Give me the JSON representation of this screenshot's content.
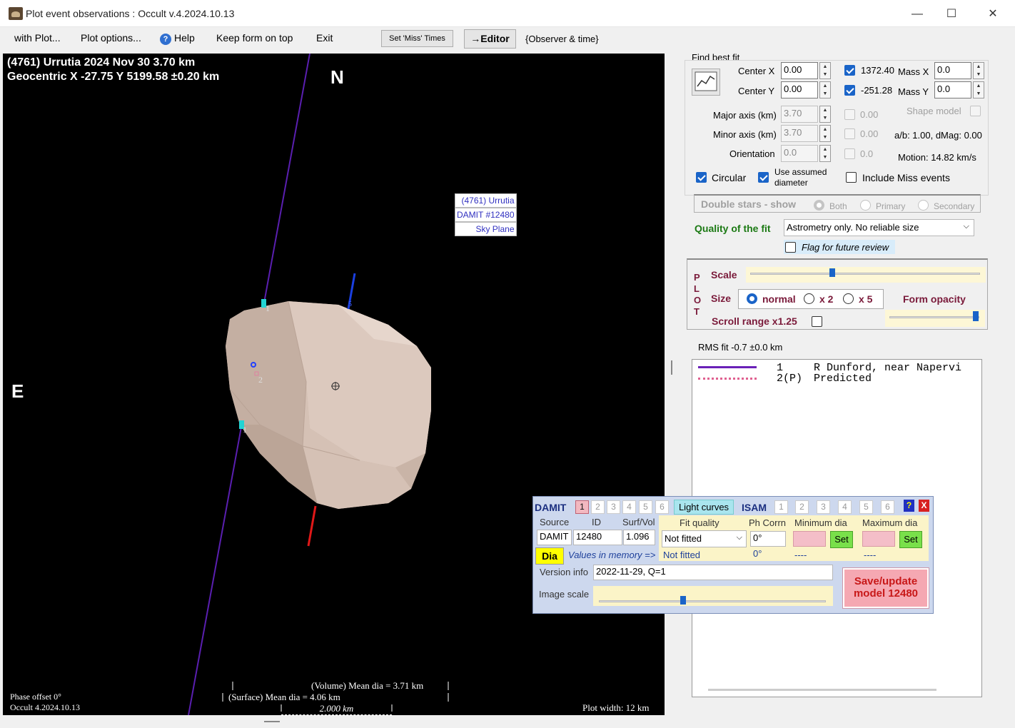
{
  "window": {
    "title": "Plot event observations : Occult v.4.2024.10.13",
    "minimize": "—",
    "maximize": "☐",
    "close": "✕"
  },
  "menu": {
    "with_plot": "with Plot...",
    "plot_options": "Plot options...",
    "help": "Help",
    "help_icon": "?",
    "keep_on_top": "Keep form on top",
    "exit": "Exit",
    "set_miss_times": "Set 'Miss' Times",
    "editor": "→Editor",
    "observer_time": "{Observer & time}"
  },
  "plot": {
    "header_line1": "(4761) Urrutia  2024 Nov 30   3.70 km",
    "header_line2": "Geocentric  X  -27.75  Y 5199.58 ±0.20 km",
    "north": "N",
    "east": "E",
    "model_label": [
      "(4761) Urrutia",
      "DAMIT #12480",
      "Sky Plane"
    ],
    "chord_labels": [
      "1",
      "2",
      "1"
    ],
    "axis_label": "5",
    "volume_mean": "(Volume) Mean dia = 3.71 km",
    "surface_mean": "(Surface) Mean dia = 4.06 km",
    "scale_bar": "2.000 km",
    "phase_offset": "Phase offset 0°",
    "occult_version": "Occult 4.2024.10.13",
    "plot_width": "Plot width: 12 km",
    "colors": {
      "background": "#000000",
      "asteroid": "#d6c3b6",
      "chord1": "#5a1fb0",
      "axis_blue": "#1a3fe0",
      "axis_red": "#e01818",
      "marker": "#22d3d3"
    }
  },
  "fit": {
    "title": "Find best fit",
    "fit_icon": "chart-icon",
    "center_x_label": "Center X",
    "center_x": "0.00",
    "center_y_label": "Center Y",
    "center_y": "0.00",
    "x_value": "1372.40",
    "mass_x_label": "Mass X",
    "mass_x": "0.0",
    "y_value": "-251.28",
    "mass_y_label": "Mass Y",
    "mass_y": "0.0",
    "major_label": "Major axis (km)",
    "major": "3.70",
    "major_extra": "0.00",
    "minor_label": "Minor axis (km)",
    "minor": "3.70",
    "minor_extra": "0.00",
    "orient_label": "Orientation",
    "orient": "0.0",
    "orient_extra": "0.0",
    "shape_model": "Shape model",
    "ab_dmag": "a/b: 1.00, dMag: 0.00",
    "motion": "Motion: 14.82 km/s",
    "circular": "Circular",
    "use_assumed": "Use assumed diameter",
    "include_miss": "Include Miss events"
  },
  "double_stars": {
    "label": "Double stars - show",
    "both": "Both",
    "primary": "Primary",
    "secondary": "Secondary"
  },
  "quality": {
    "label": "Quality of the fit",
    "value": "Astrometry only. No reliable size",
    "flag": "Flag for future review"
  },
  "plotgroup": {
    "letters": [
      "P",
      "L",
      "O",
      "T"
    ],
    "scale": "Scale",
    "size": "Size",
    "normal": "normal",
    "x2": "x 2",
    "x5": "x 5",
    "form_opacity": "Form opacity",
    "scroll_range": "Scroll range x1.25"
  },
  "rms": "RMS fit -0.7 ±0.0 km",
  "observers": [
    {
      "num": "1",
      "name": "R Dunford, near Napervi"
    },
    {
      "num": "2(P)",
      "name": "Predicted"
    }
  ],
  "damit": {
    "title": "DAMIT",
    "nums": [
      "1",
      "2",
      "3",
      "4",
      "5",
      "6"
    ],
    "light_curves": "Light curves",
    "isam": "ISAM",
    "isam_nums": [
      "1",
      "2",
      "3",
      "4",
      "5",
      "6"
    ],
    "help": "?",
    "close": "X",
    "source_label": "Source",
    "id_label": "ID",
    "surf_label": "Surf/Vol",
    "source": "DAMIT",
    "id": "12480",
    "surf": "1.096",
    "fit_quality_label": "Fit quality",
    "ph_corrn_label": "Ph Corrn",
    "min_dia_label": "Minimum dia",
    "max_dia_label": "Maximum dia",
    "fit_quality": "Not fitted",
    "ph_corrn": "0°",
    "set": "Set",
    "dia": "Dia",
    "values_in_memory": "Values in memory =>",
    "mem_fit": "Not fitted",
    "mem_ph": "0°",
    "mem_min": "----",
    "mem_max": "----",
    "version_label": "Version info",
    "version": "2022-11-29, Q=1",
    "image_scale": "Image scale",
    "save_update": "Save/update model 12480"
  }
}
